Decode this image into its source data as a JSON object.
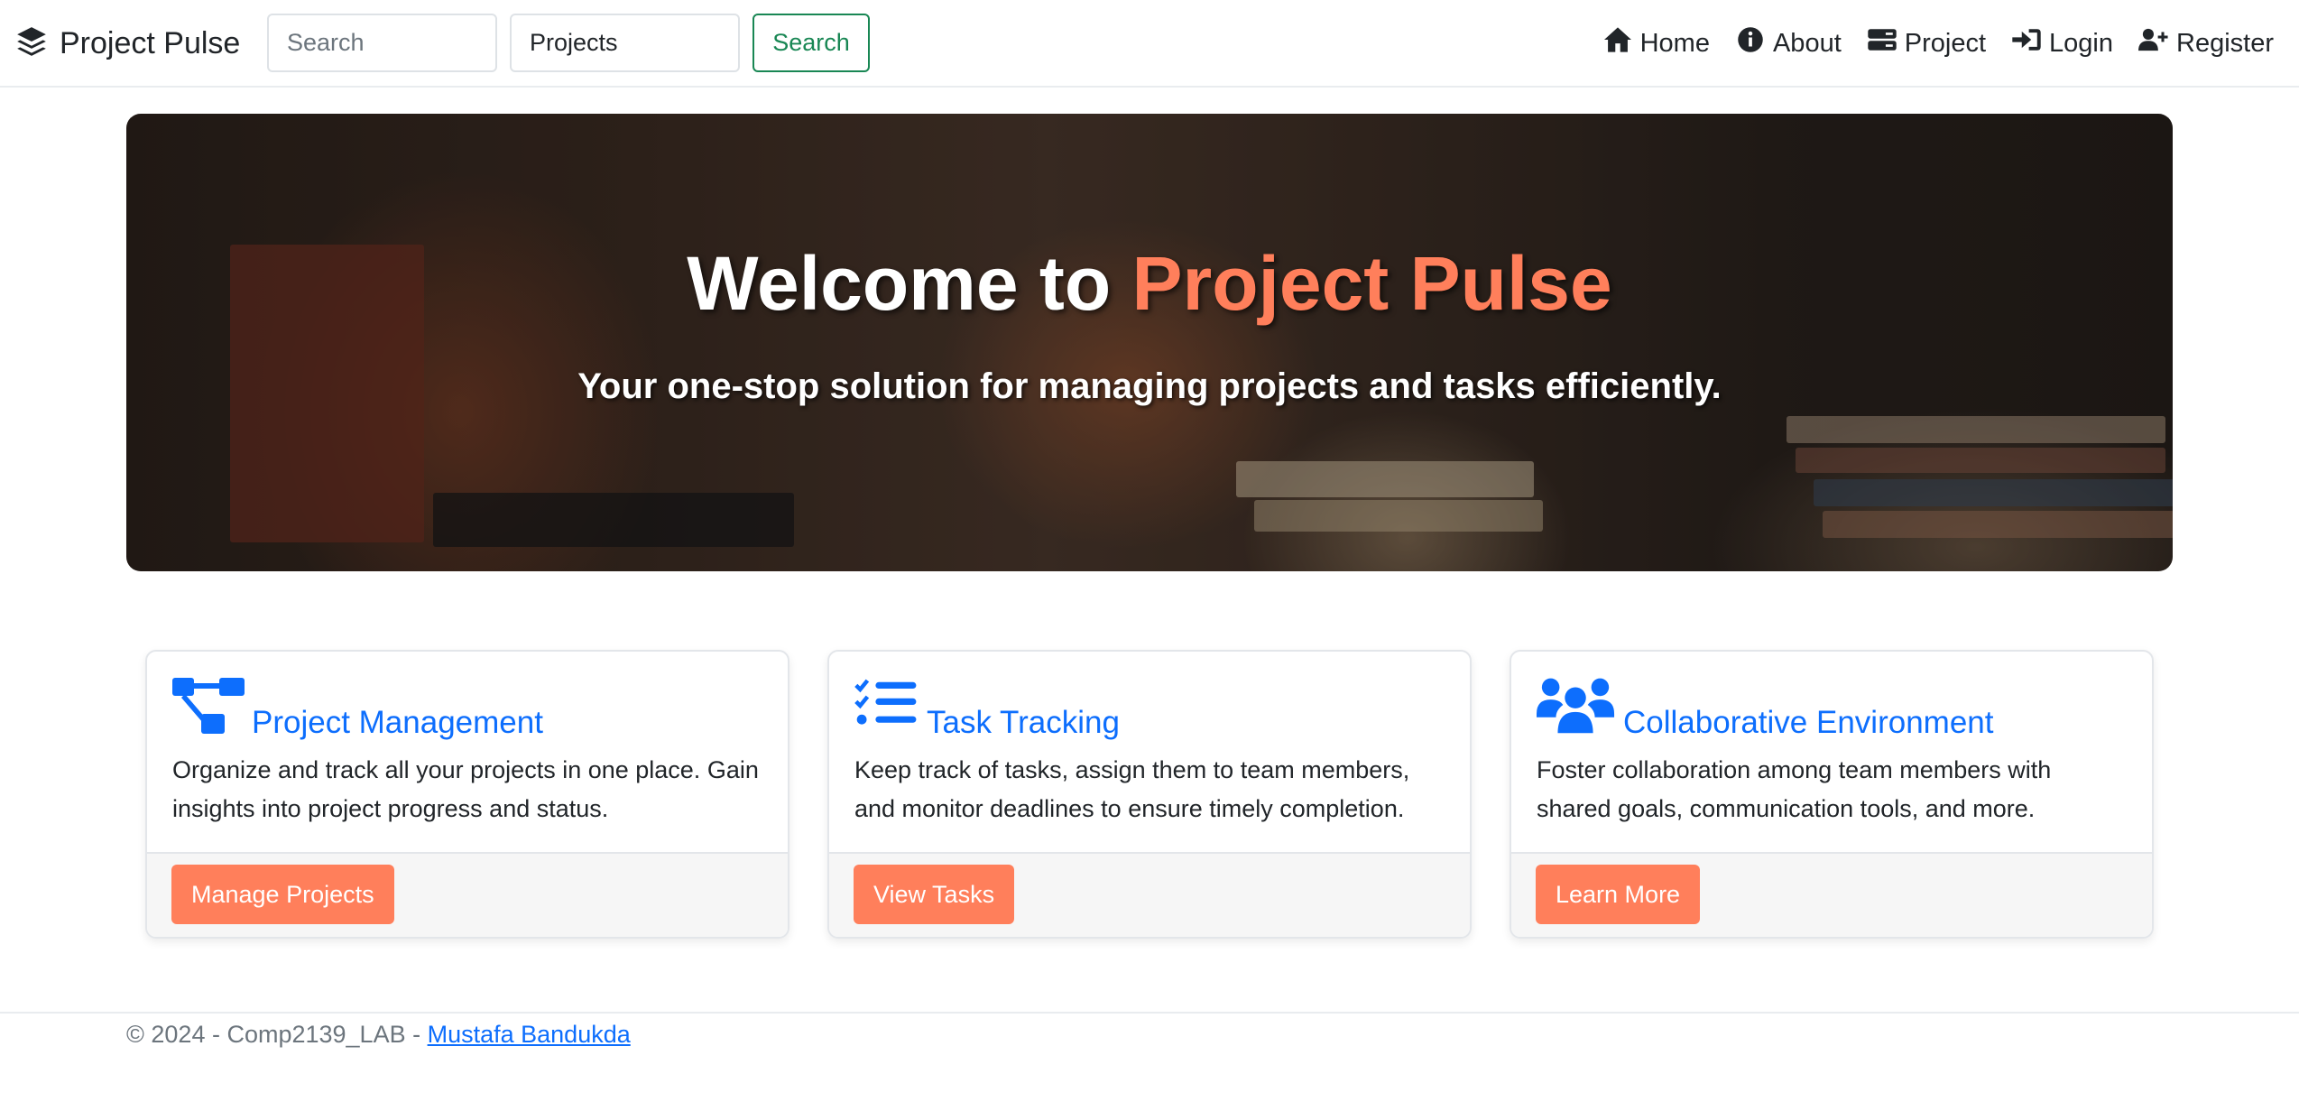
{
  "brand": {
    "name": "Project Pulse",
    "icon": "layer-group-icon"
  },
  "search": {
    "placeholder": "Search",
    "category_value": "Projects",
    "button_label": "Search"
  },
  "nav": {
    "items": [
      {
        "label": "Home",
        "icon": "home-icon"
      },
      {
        "label": "About",
        "icon": "info-circle-icon"
      },
      {
        "label": "Project",
        "icon": "server-icon"
      },
      {
        "label": "Login",
        "icon": "sign-in-icon"
      },
      {
        "label": "Register",
        "icon": "user-plus-icon"
      }
    ]
  },
  "hero": {
    "title_prefix": "Welcome to ",
    "title_accent": "Project Pulse",
    "subtitle": "Your one-stop solution for managing projects and tasks efficiently."
  },
  "cards": [
    {
      "title": "Project Management",
      "icon": "project-diagram-icon",
      "text": "Organize and track all your projects in one place. Gain insights into project progress and status.",
      "button": "Manage Projects"
    },
    {
      "title": "Task Tracking",
      "icon": "tasks-list-icon",
      "text": "Keep track of tasks, assign them to team members, and monitor deadlines to ensure timely completion.",
      "button": "View Tasks"
    },
    {
      "title": "Collaborative Environment",
      "icon": "users-icon",
      "text": "Foster collaboration among team members with shared goals, communication tools, and more.",
      "button": "Learn More"
    }
  ],
  "footer": {
    "text": "© 2024 - Comp2139_LAB - ",
    "link_text": "Mustafa Bandukda"
  },
  "colors": {
    "accent": "#ff7f5b",
    "link": "#0d6efd",
    "success": "#198754"
  }
}
